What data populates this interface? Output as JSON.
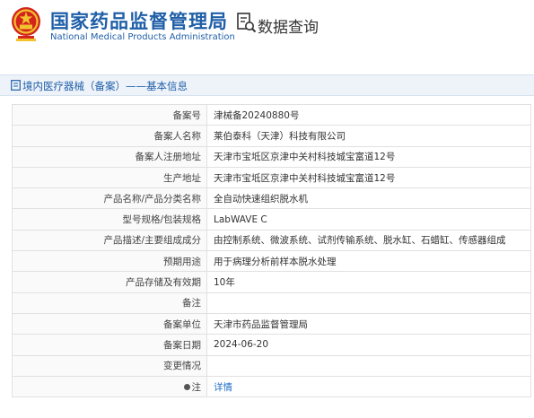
{
  "header": {
    "org_name_cn": "国家药品监督管理局",
    "org_name_en": "National Medical Products Administration",
    "query_title": "数据查询",
    "emblem_icon": "national-emblem-icon",
    "query_icon": "document-search-icon",
    "brand_color": "#1f5fa8",
    "emblem_color": "#d3251c"
  },
  "breadcrumb": {
    "icon": "document-icon",
    "text": "境内医疗器械（备案）——基本信息"
  },
  "record": {
    "rows": [
      {
        "label": "备案号",
        "value": "津械备20240880号"
      },
      {
        "label": "备案人名称",
        "value": "莱伯泰科（天津）科技有限公司"
      },
      {
        "label": "备案人注册地址",
        "value": "天津市宝坻区京津中关村科技城宝富道12号"
      },
      {
        "label": "生产地址",
        "value": "天津市宝坻区京津中关村科技城宝富道12号"
      },
      {
        "label": "产品名称/产品分类名称",
        "value": "全自动快速组织脱水机"
      },
      {
        "label": "型号规格/包装规格",
        "value": "LabWAVE C"
      },
      {
        "label": "产品描述/主要组成成分",
        "value": "由控制系统、微波系统、试剂传输系统、脱水缸、石蜡缸、传感器组成"
      },
      {
        "label": "预期用途",
        "value": "用于病理分析前样本脱水处理"
      },
      {
        "label": "产品存储及有效期",
        "value": "10年"
      },
      {
        "label": "备注",
        "value": ""
      },
      {
        "label": "备案单位",
        "value": "天津市药品监督管理局"
      },
      {
        "label": "备案日期",
        "value": "2024-06-20"
      },
      {
        "label": "变更情况",
        "value": ""
      }
    ],
    "note": {
      "label": "注",
      "icon": "bullet-icon",
      "link_text": "详情"
    }
  }
}
